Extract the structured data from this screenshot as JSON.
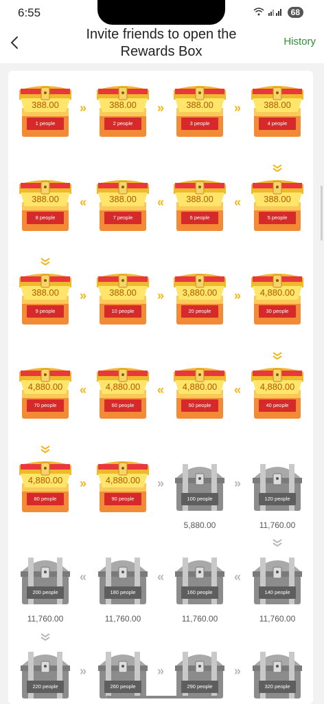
{
  "status": {
    "time": "6:55",
    "battery": "68"
  },
  "header": {
    "title": "Invite friends to open the Rewards Box",
    "history": "History"
  },
  "boxes": [
    {
      "people": "1 people",
      "amount": "388.00",
      "state": "gold"
    },
    {
      "people": "2 people",
      "amount": "388.00",
      "state": "gold"
    },
    {
      "people": "3 people",
      "amount": "388.00",
      "state": "gold"
    },
    {
      "people": "4 people",
      "amount": "388.00",
      "state": "gold"
    },
    {
      "people": "5 people",
      "amount": "388.00",
      "state": "gold"
    },
    {
      "people": "6 people",
      "amount": "388.00",
      "state": "gold"
    },
    {
      "people": "7 people",
      "amount": "388.00",
      "state": "gold"
    },
    {
      "people": "8 people",
      "amount": "388.00",
      "state": "gold"
    },
    {
      "people": "9 people",
      "amount": "388.00",
      "state": "gold"
    },
    {
      "people": "10 people",
      "amount": "388.00",
      "state": "gold"
    },
    {
      "people": "20 people",
      "amount": "3,880.00",
      "state": "gold"
    },
    {
      "people": "30 people",
      "amount": "4,880.00",
      "state": "gold"
    },
    {
      "people": "40 people",
      "amount": "4,880.00",
      "state": "gold"
    },
    {
      "people": "50 people",
      "amount": "4,880.00",
      "state": "gold"
    },
    {
      "people": "60 people",
      "amount": "4,880.00",
      "state": "gold"
    },
    {
      "people": "70 people",
      "amount": "4,880.00",
      "state": "gold"
    },
    {
      "people": "80 people",
      "amount": "4,880.00",
      "state": "gold"
    },
    {
      "people": "90 people",
      "amount": "4,880.00",
      "state": "gold"
    },
    {
      "people": "100 people",
      "amount": "5,880.00",
      "state": "silver"
    },
    {
      "people": "120 people",
      "amount": "11,760.00",
      "state": "silver"
    },
    {
      "people": "140 people",
      "amount": "11,760.00",
      "state": "silver"
    },
    {
      "people": "160 people",
      "amount": "11,760.00",
      "state": "silver"
    },
    {
      "people": "180 people",
      "amount": "11,760.00",
      "state": "silver"
    },
    {
      "people": "200 people",
      "amount": "11,760.00",
      "state": "silver"
    },
    {
      "people": "220 people",
      "amount": "",
      "state": "silver"
    },
    {
      "people": "260 people",
      "amount": "",
      "state": "silver"
    },
    {
      "people": "290 people",
      "amount": "",
      "state": "silver"
    },
    {
      "people": "320 people",
      "amount": "",
      "state": "silver"
    }
  ],
  "colors": {
    "gold_chevron": "#f2b619",
    "gray_chevron": "#b8b8b8",
    "history_green": "#2f8f2f",
    "plate_red": "#d62a2a",
    "plate_gray": "#5e5e5e"
  },
  "icons": {
    "back": "back-arrow-icon",
    "chest_gold": "gold-treasure-chest-icon",
    "chest_silver": "silver-treasure-chest-icon",
    "chevron": "double-chevron-icon"
  }
}
